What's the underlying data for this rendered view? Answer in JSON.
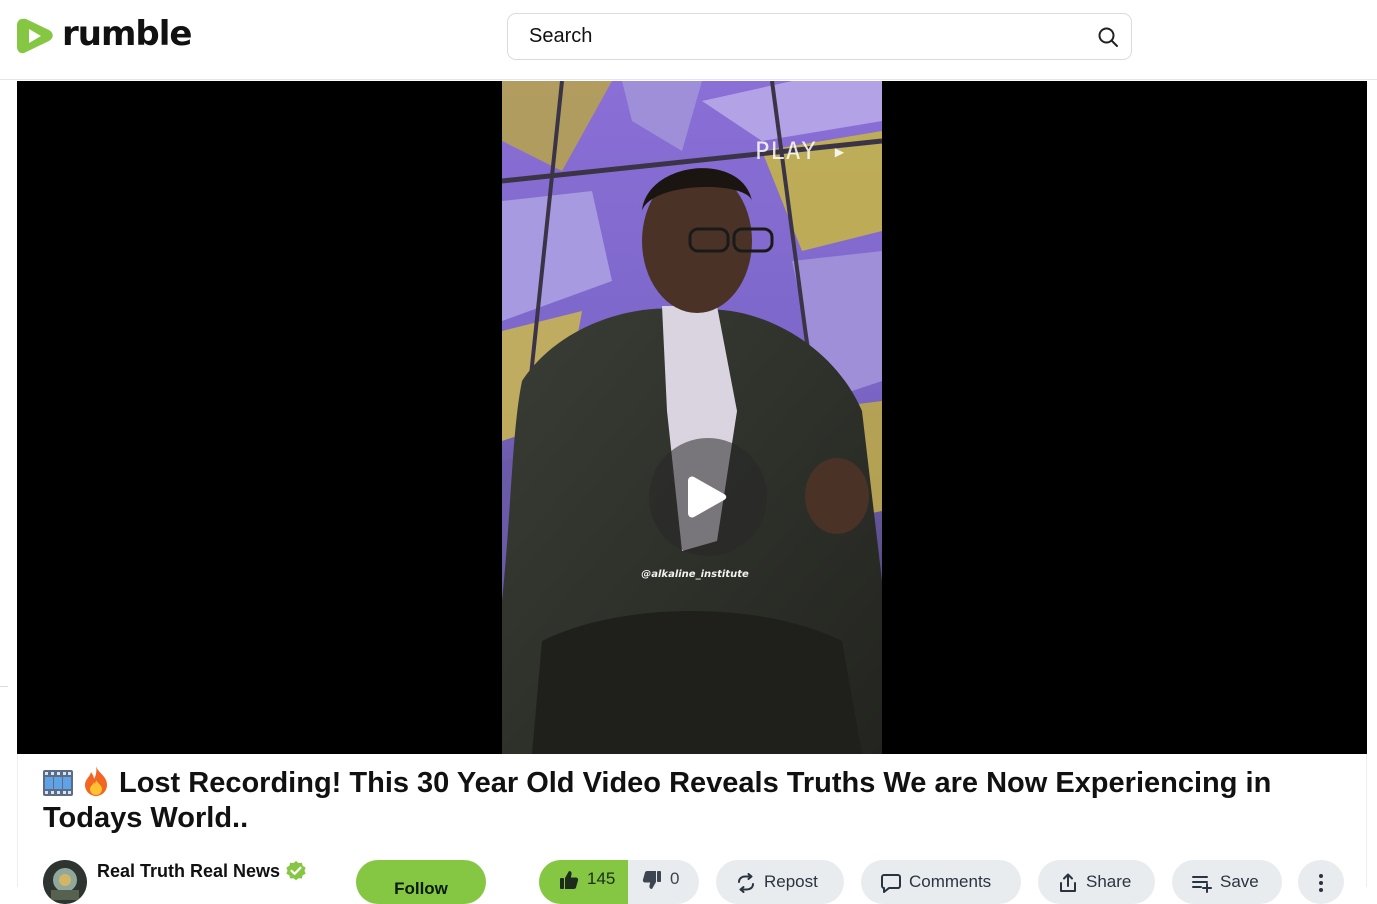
{
  "header": {
    "logo_text": "rumble",
    "search_placeholder": "Search"
  },
  "video": {
    "overlay_sign": "PLAY ▸",
    "watermark": "@alkaline_institute"
  },
  "title": {
    "emojis": [
      "film-frames-emoji",
      "fire-emoji"
    ],
    "text": "Lost Recording! This 30 Year Old Video Reveals Truths We are Now Experiencing in Todays World.."
  },
  "channel": {
    "name": "Real Truth Real News",
    "verified": true,
    "follow_label": "Follow"
  },
  "actions": {
    "likes": "145",
    "dislikes": "0",
    "repost_label": "Repost",
    "comments_label": "Comments",
    "share_label": "Share",
    "save_label": "Save"
  },
  "colors": {
    "brand_green": "#85c742",
    "pill_bg": "#e9ecef",
    "player_bg": "#000000"
  }
}
